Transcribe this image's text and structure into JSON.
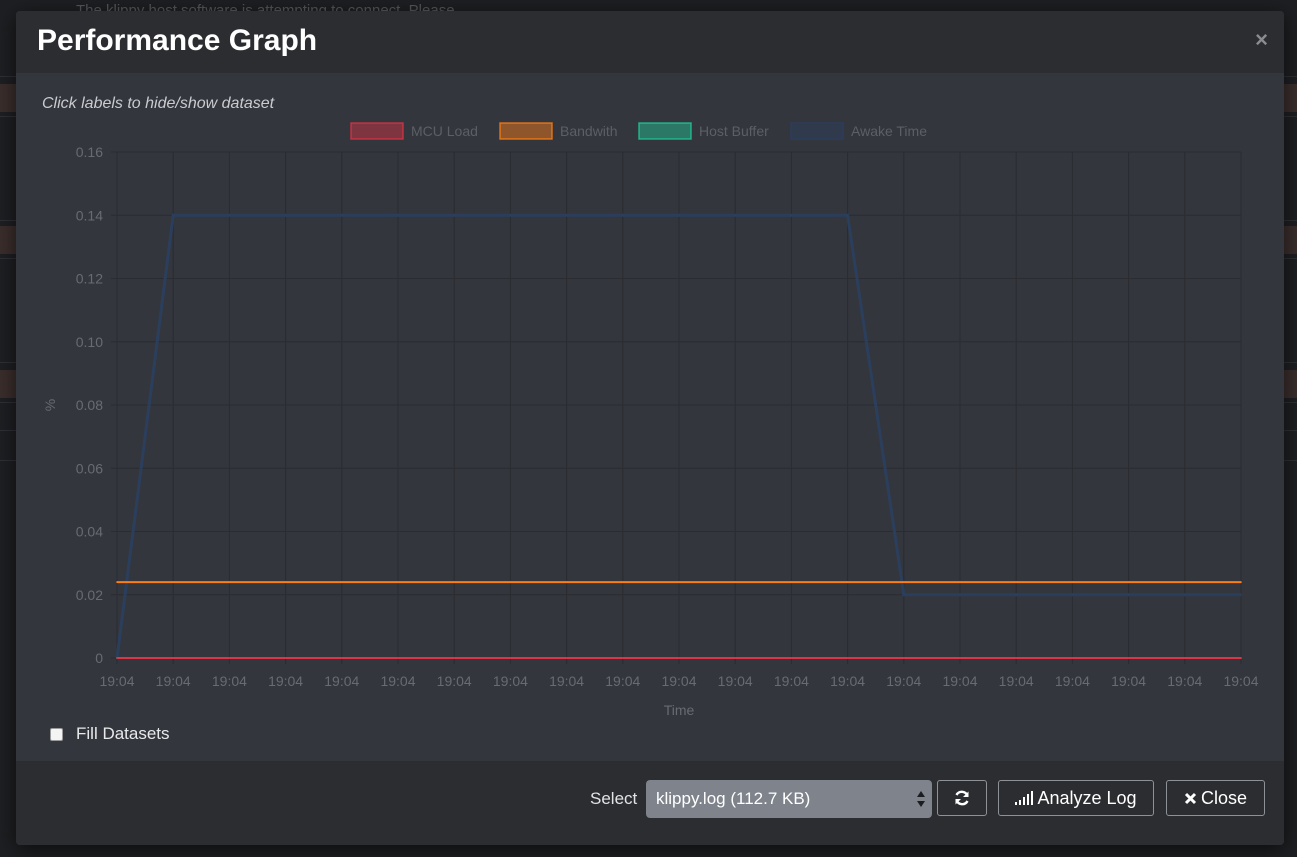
{
  "background": {
    "partial_text": "The klippy host software is attempting to connect. Please"
  },
  "modal": {
    "title": "Performance Graph",
    "close_symbol": "×",
    "hint": "Click labels to hide/show dataset",
    "fill_datasets_label": "Fill Datasets",
    "fill_datasets_checked": false
  },
  "footer": {
    "select_label": "Select",
    "select_value": "klippy.log (112.7 KB)",
    "refresh_icon": "refresh-icon",
    "analyze_label": "Analyze Log",
    "analyze_icon": "signal-bars-icon",
    "close_label": "Close",
    "close_icon": "x-mark-icon"
  },
  "chart_data": {
    "type": "line",
    "title": "",
    "xlabel": "Time",
    "ylabel": "%",
    "ylim": [
      0,
      0.16
    ],
    "y_ticks": [
      "0.16",
      "0.14",
      "0.12",
      "0.10",
      "0.08",
      "0.06",
      "0.04",
      "0.02",
      "0"
    ],
    "categories": [
      "19:04",
      "19:04",
      "19:04",
      "19:04",
      "19:04",
      "19:04",
      "19:04",
      "19:04",
      "19:04",
      "19:04",
      "19:04",
      "19:04",
      "19:04",
      "19:04",
      "19:04",
      "19:04",
      "19:04",
      "19:04",
      "19:04",
      "19:04",
      "19:04"
    ],
    "grid": true,
    "legend_position": "top",
    "series": [
      {
        "name": "MCU Load",
        "color": "#dc3545",
        "values": [
          0,
          0,
          0,
          0,
          0,
          0,
          0,
          0,
          0,
          0,
          0,
          0,
          0,
          0,
          0,
          0,
          0,
          0,
          0,
          0,
          0
        ]
      },
      {
        "name": "Bandwith",
        "color": "#fd7e14",
        "values": [
          0.024,
          0.024,
          0.024,
          0.024,
          0.024,
          0.024,
          0.024,
          0.024,
          0.024,
          0.024,
          0.024,
          0.024,
          0.024,
          0.024,
          0.024,
          0.024,
          0.024,
          0.024,
          0.024,
          0.024,
          0.024
        ]
      },
      {
        "name": "Host Buffer",
        "color": "#20c997",
        "values": [
          0,
          0,
          0,
          0,
          0,
          0,
          0,
          0,
          0,
          0,
          0,
          0,
          0,
          0,
          0,
          0,
          0,
          0,
          0,
          0,
          0
        ]
      },
      {
        "name": "Awake Time",
        "color": "#2a4060",
        "values": [
          0,
          0.14,
          0.14,
          0.14,
          0.14,
          0.14,
          0.14,
          0.14,
          0.14,
          0.14,
          0.14,
          0.14,
          0.14,
          0.14,
          0.02,
          0.02,
          0.02,
          0.02,
          0.02,
          0.02,
          0.02
        ]
      }
    ]
  }
}
